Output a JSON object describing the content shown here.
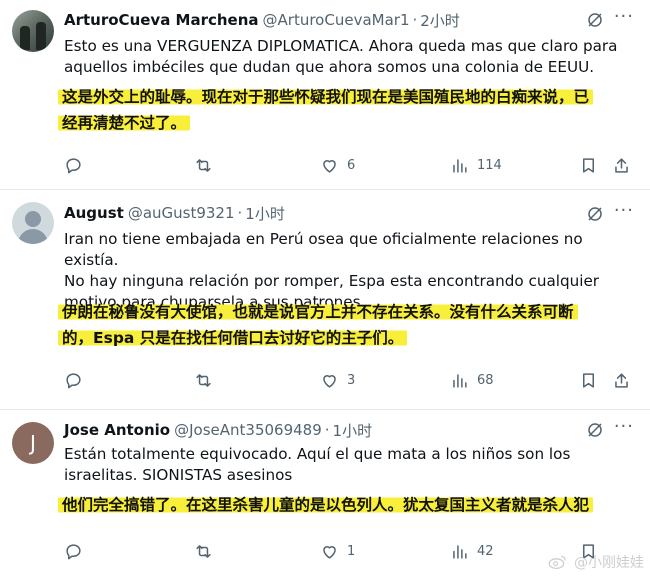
{
  "tweets": [
    {
      "name": "ArturoCueva Marchena",
      "handle": "@ArturoCuevaMar1",
      "time": "2小时",
      "text": "Esto es una VERGUENZA DIPLOMATICA. Ahora queda mas que claro para\naquellos imbéciles que dudan que ahora somos una colonia de EEUU.",
      "translation": "这是外交上的耻辱。现在对于那些怀疑我们现在是美国殖民地的白痴来说，已\n经再清楚不过了。",
      "likes": "6",
      "views": "114",
      "avatar_icon": "photo-avatar"
    },
    {
      "name": "August",
      "handle": "@auGust9321",
      "time": "1小时",
      "text": "Iran no tiene embajada en Perú osea que oficialmente relaciones no existía.\nNo hay ninguna relación por romper, Espa esta encontrando cualquier\nmotivo para chuparsela a sus patrones.",
      "translation": "伊朗在秘鲁没有大使馆，也就是说官方上并不存在关系。没有什么关系可断\n的，Espa 只是在找任何借口去讨好它的主子们。",
      "likes": "3",
      "views": "68",
      "avatar_icon": "default-user-icon"
    },
    {
      "name": "Jose Antonio",
      "handle": "@JoseAnt35069489",
      "time": "1小时",
      "text": "Están totalmente equivocado. Aquí el que mata a los niños son los\nisraelitas. SIONISTAS asesinos",
      "translation": "他们完全搞错了。在这里杀害儿童的是以色列人。犹太复国主义者就是杀人犯",
      "likes": "1",
      "views": "42",
      "avatar_letter": "J"
    }
  ],
  "dot": "·",
  "more_glyph": "···",
  "watermark": "@小刚娃娃",
  "colors": {
    "highlight": "#f8ef3b",
    "secondary_text": "#536471",
    "divider": "#e6e9ec"
  }
}
